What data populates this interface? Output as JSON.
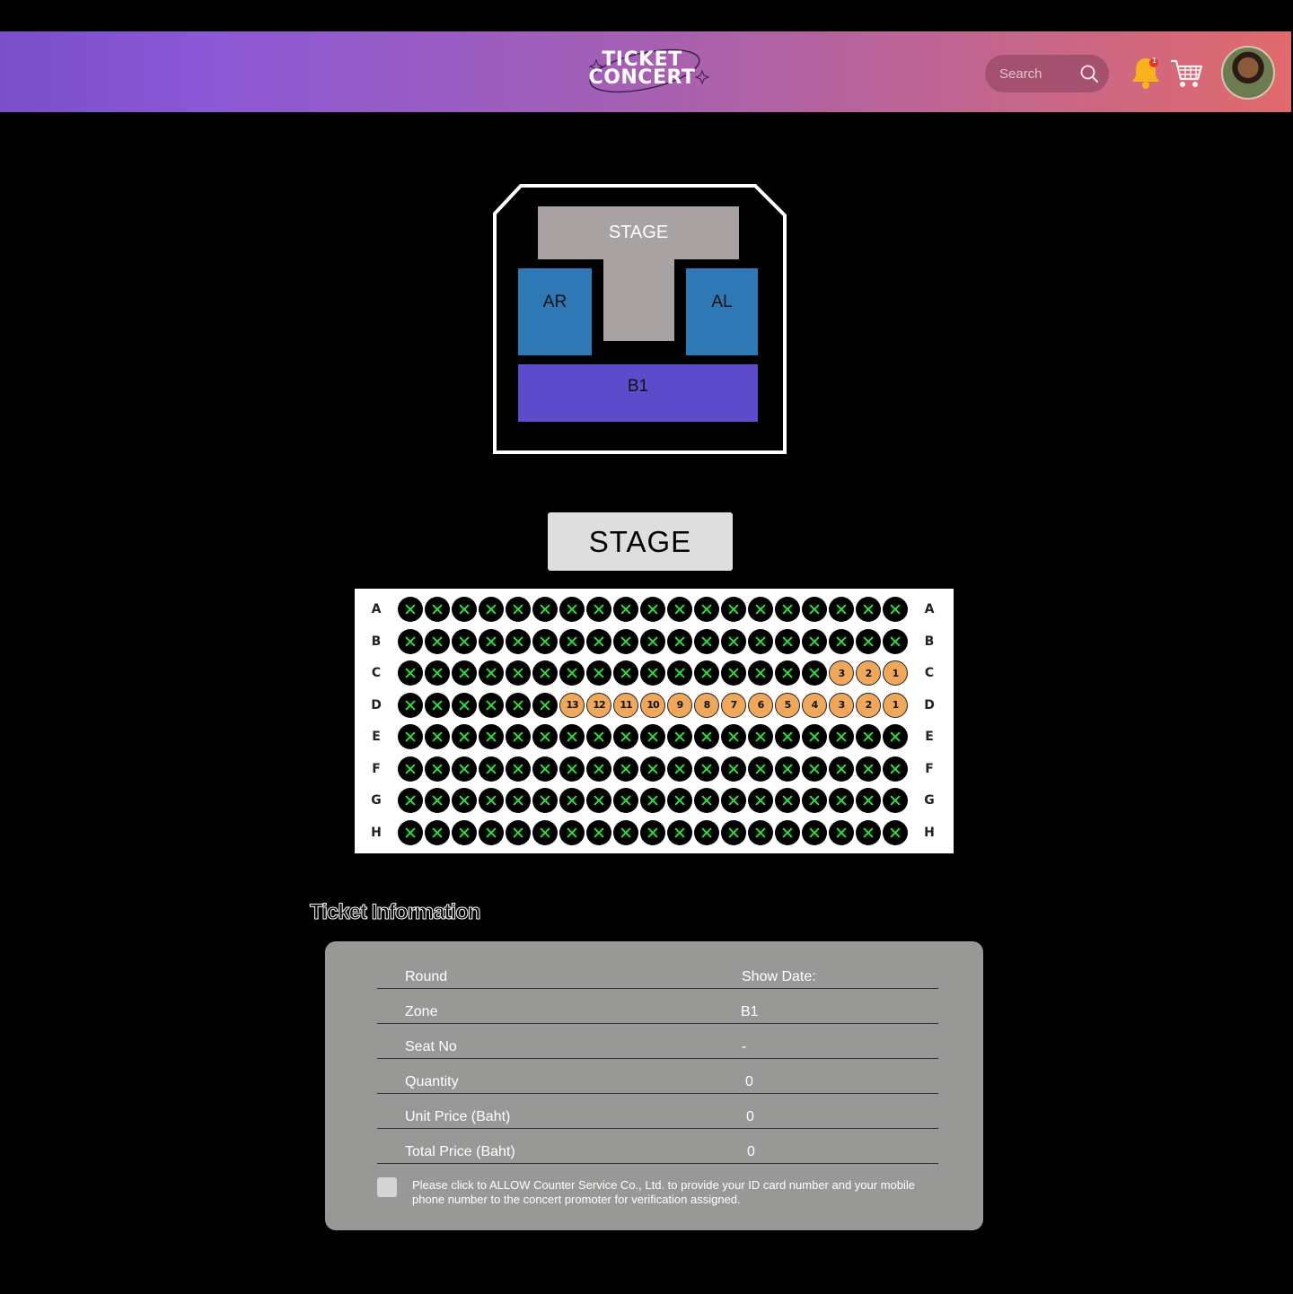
{
  "header": {
    "logo_line1": "TICKET",
    "logo_line2": "CONCERT",
    "search_placeholder": "Search",
    "notification_count": "1",
    "icons": [
      "search-icon",
      "bell-icon",
      "cart-icon"
    ],
    "colors": {
      "gradient_start": "#7a4fc9",
      "gradient_end": "#e06a6c"
    }
  },
  "venue_map": {
    "stage_label": "STAGE",
    "zones": [
      {
        "id": "ar",
        "label": "AR",
        "color": "#2f78b6"
      },
      {
        "id": "al",
        "label": "AL",
        "color": "#2f78b6"
      },
      {
        "id": "b1",
        "label": "B1",
        "color": "#5c4bcb"
      }
    ]
  },
  "stage_button": {
    "label": "STAGE"
  },
  "seat_map": {
    "colors": {
      "taken": "#000000",
      "taken_mark": "#2fdc3a",
      "available": "#efa85b"
    },
    "seats_per_row": 19,
    "rows": [
      {
        "label": "A",
        "available": []
      },
      {
        "label": "B",
        "available": []
      },
      {
        "label": "C",
        "available": [
          "3",
          "2",
          "1"
        ]
      },
      {
        "label": "D",
        "available": [
          "13",
          "12",
          "11",
          "10",
          "9",
          "8",
          "7",
          "6",
          "5",
          "4",
          "3",
          "2",
          "1"
        ]
      },
      {
        "label": "E",
        "available": []
      },
      {
        "label": "F",
        "available": []
      },
      {
        "label": "G",
        "available": []
      },
      {
        "label": "H",
        "available": []
      }
    ]
  },
  "ticket_info": {
    "title": "Ticket Information",
    "rows": [
      {
        "label": "Round",
        "value": "Show Date:"
      },
      {
        "label": "Zone",
        "value": "B1"
      },
      {
        "label": "Seat No",
        "value": "-"
      },
      {
        "label": "Quantity",
        "value": "0"
      },
      {
        "label": "Unit Price (Baht)",
        "value": "0"
      },
      {
        "label": "Total Price (Baht)",
        "value": "0"
      }
    ],
    "consent_text": "Please click to ALLOW Counter Service Co., Ltd. to provide your ID card number and your mobile phone number to the concert promoter for verification assigned."
  }
}
